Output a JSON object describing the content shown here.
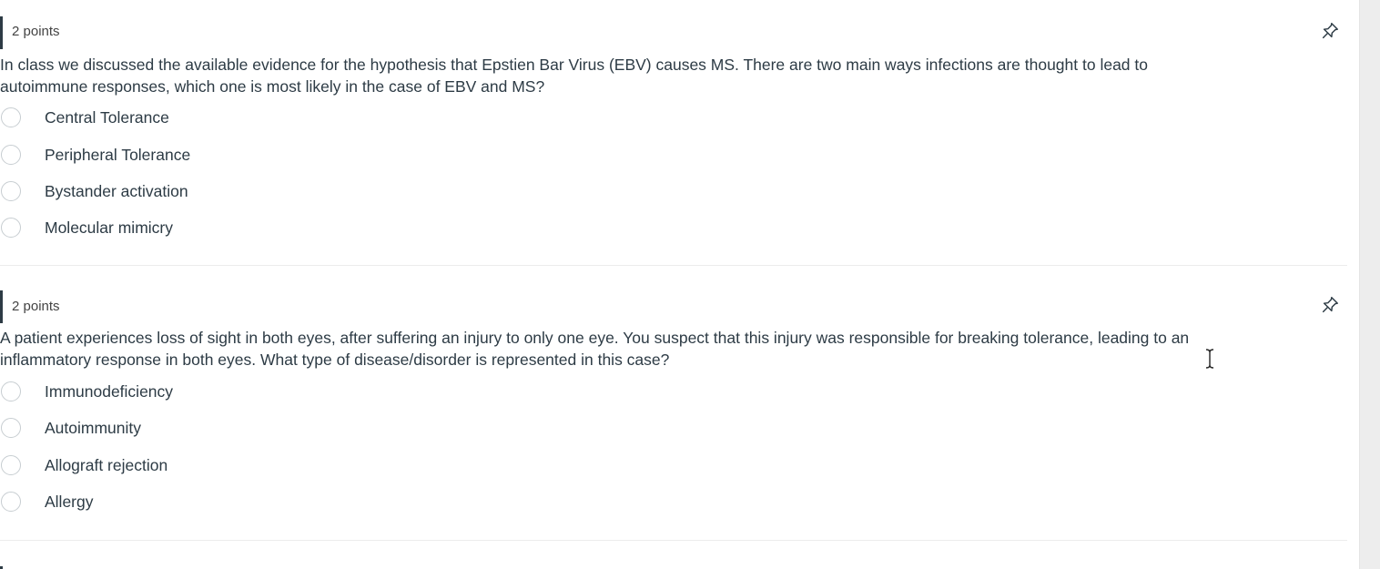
{
  "questions": [
    {
      "points": "2 points",
      "text": "In class we discussed the available evidence for the hypothesis that Epstien Bar Virus (EBV) causes MS.  There are two main ways infections are thought to lead to autoimmune responses, which one is most likely in the case of EBV and MS?",
      "text_lines": [
        "In class we discussed the available evidence for the hypothesis that Epstien Bar Virus (EBV) causes MS.  There are two main ways infections are thought to lead to",
        "autoimmune responses, which one is most likely in the case of EBV and MS?"
      ],
      "options": [
        "Central Tolerance",
        "Peripheral Tolerance",
        "Bystander activation",
        "Molecular mimicry"
      ]
    },
    {
      "points": "2 points",
      "text_lines": [
        "A patient experiences loss of sight in both eyes, after suffering an injury to only one eye.  You suspect that this injury was responsible for breaking tolerance, leading to an",
        "inflammatory response in both eyes.  What type of disease/disorder is represented in this case?"
      ],
      "options": [
        "Immunodeficiency",
        "Autoimmunity",
        "Allograft rejection",
        "Allergy"
      ]
    }
  ],
  "icons": {
    "pin": "pin-icon",
    "radio": "radio-button",
    "cursor": "text-cursor-icon"
  },
  "colors": {
    "text": "#2d3b45",
    "radio_border": "#c7cdd1",
    "divider": "#ececec"
  }
}
